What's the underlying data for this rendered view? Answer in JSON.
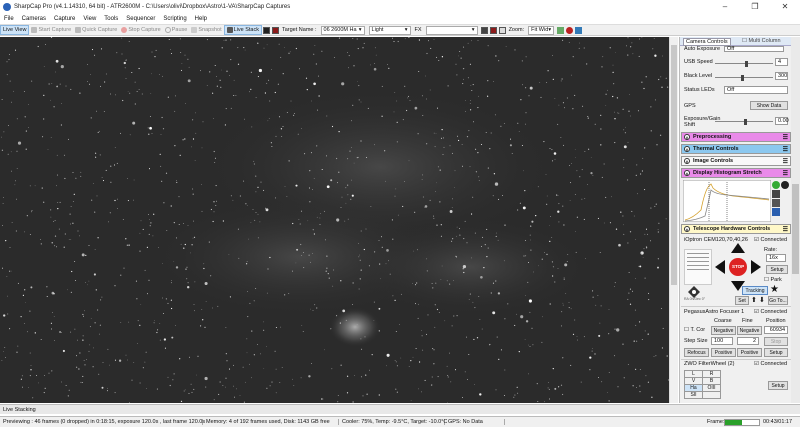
{
  "window": {
    "title": "SharpCap Pro (v4.1.14310, 64 bit) - ATR2600M - C:\\Users\\olivi\\Dropbox\\Astro\\1-VA\\SharpCap Captures"
  },
  "menu": [
    "File",
    "Cameras",
    "Capture",
    "View",
    "Tools",
    "Sequencer",
    "Scripting",
    "Help"
  ],
  "toolbar": {
    "live_view": "Live View",
    "start_capture": "Start Capture",
    "quick_capture": "Quick Capture",
    "stop_capture": "Stop Capture",
    "pause": "Pause",
    "snapshot": "Snapshot",
    "live_stack": "Live Stack",
    "target_label": "Target Name :",
    "target_value": "06 2600M Ha",
    "frame_type": "Light",
    "fx_label": "FX",
    "zoom_label": "Zoom:",
    "zoom_value": "Fit Wid"
  },
  "panel": {
    "tab_camera": "Camera Controls",
    "tab_multi": "Multi Column",
    "auto_exposure": "Auto Exposure",
    "auto_exposure_val": "Off",
    "usb_speed_label": "USB Speed",
    "usb_speed_val": "4",
    "black_level_label": "Black Level",
    "black_level_val": "300",
    "status_leds_label": "Status LEDs",
    "status_leds_val": "Off",
    "gps_label": "GPS",
    "show_data": "Show Data",
    "exp_gain_label": "Exposure/Gain Shift",
    "exp_gain_val": "0.00",
    "sec_preprocessing": "Preprocessing",
    "sec_thermal": "Thermal Controls",
    "sec_image": "Image Controls",
    "sec_histogram": "Display Histogram Stretch",
    "sec_telescope": "Telescope Hardware Controls",
    "mount_name": "iOptron CEM120,70,40,26",
    "connected": "Connected",
    "rate_label": "Rate:",
    "rate_val": "16x",
    "setup": "Setup",
    "park": "Park",
    "stop": "STOP",
    "tracking": "Tracking",
    "set": "Set",
    "goto": "Go To...",
    "focuser_name": "PegasusAstro Focuser 1",
    "coarse": "Coarse",
    "fine": "Fine",
    "position": "Position",
    "t_comp": "T. Cor",
    "negative": "Negative",
    "positive": "Positive",
    "position_val": "60934",
    "step_size_label": "Step Size",
    "step_size_val": "100",
    "fine_step_val": "2",
    "stop_btn": "Stop",
    "refocus": "Refocus",
    "filterwheel_name": "ZWO FilterWheel (2)",
    "filters": [
      [
        "L",
        "R"
      ],
      [
        "V",
        "B"
      ],
      [
        "Ha",
        "OIII"
      ],
      [
        "SII",
        ""
      ]
    ]
  },
  "status": {
    "live_stacking": "Live Stacking",
    "previewing": "Previewing : 46 frames (0 dropped) in 0:18:15, exposure 120.0s , last frame 120.0s",
    "memory": "Memory: 4 of 192 frames used, Disk: 1143 GB free",
    "cooler": "Cooler: 75%, Temp: -9.5°C, Target: -10.0°C",
    "gps": "GPS: No Data",
    "frame_label": "Frame:",
    "frame_time": "00:43/01:17"
  }
}
